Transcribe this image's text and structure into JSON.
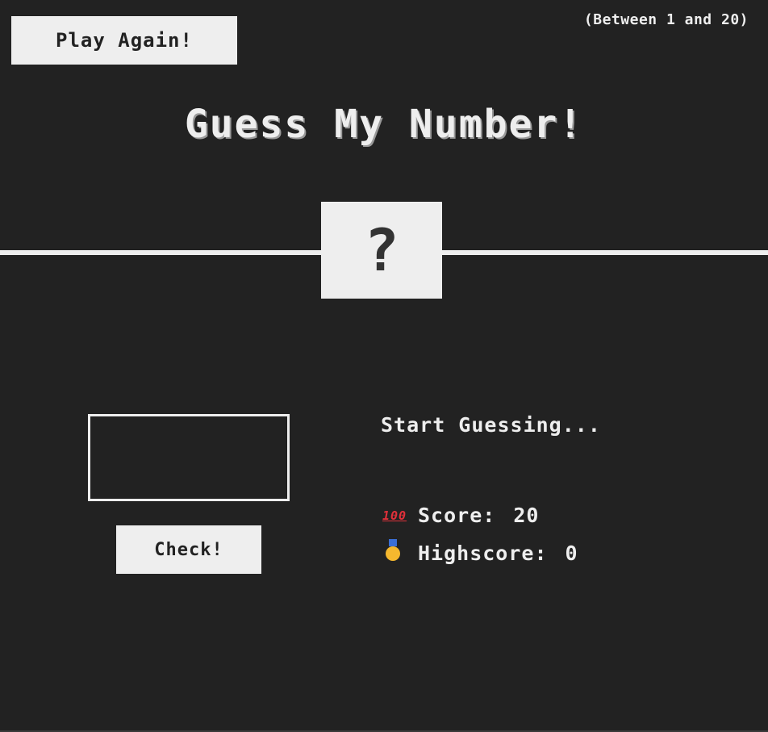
{
  "header": {
    "again_label": "Play Again!",
    "between_text": "(Between 1 and 20)"
  },
  "title": "Guess My Number!",
  "secret_number": "?",
  "guess_input": {
    "value": ""
  },
  "check_label": "Check!",
  "message": "Start Guessing...",
  "score": {
    "icon": "hundred-points-icon",
    "label": "Score:",
    "value": "20"
  },
  "highscore": {
    "icon": "medal-icon",
    "label": "Highscore:",
    "value": "0"
  },
  "colors": {
    "background": "#222222",
    "foreground": "#eeeeee"
  }
}
